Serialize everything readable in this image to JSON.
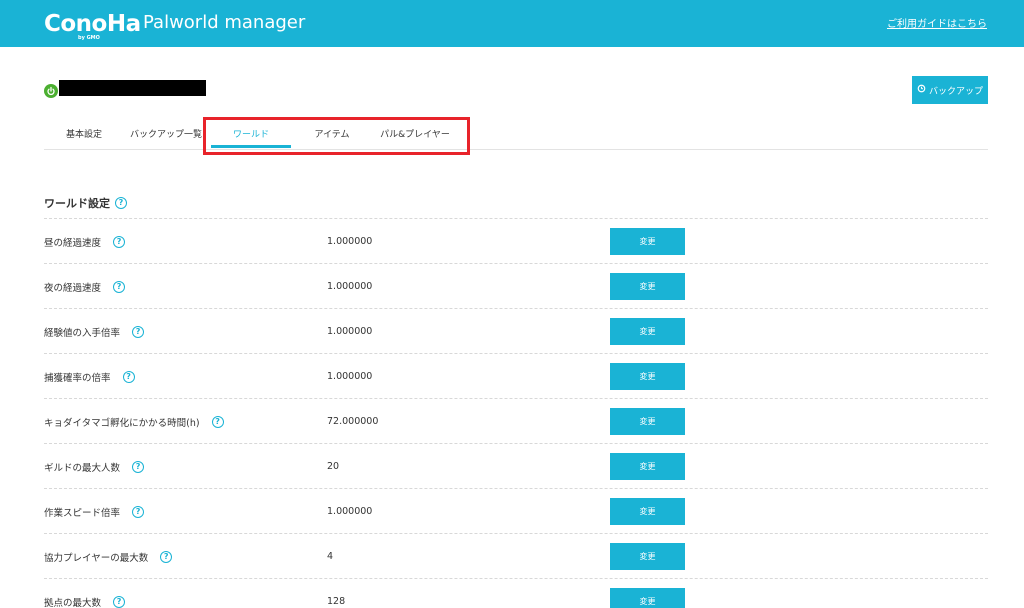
{
  "header": {
    "logo_text": "ConoHa",
    "logo_sub": "by GMO",
    "app_title": "Palworld manager",
    "guide_link": "ご利用ガイドはこちら"
  },
  "server": {
    "status_icon": "power-icon",
    "status_color": "#4caf31"
  },
  "actions": {
    "backup_label": "バックアップ"
  },
  "tabs": [
    {
      "label": "基本設定",
      "active": false
    },
    {
      "label": "バックアップ一覧",
      "active": false
    },
    {
      "label": "ワールド",
      "active": true
    },
    {
      "label": "アイテム",
      "active": false
    },
    {
      "label": "パル&プレイヤー",
      "active": false
    }
  ],
  "section": {
    "title": "ワールド設定"
  },
  "settings": [
    {
      "label": "昼の経過速度",
      "value": "1.000000",
      "button": "変更"
    },
    {
      "label": "夜の経過速度",
      "value": "1.000000",
      "button": "変更"
    },
    {
      "label": "経験値の入手倍率",
      "value": "1.000000",
      "button": "変更"
    },
    {
      "label": "捕獲確率の倍率",
      "value": "1.000000",
      "button": "変更"
    },
    {
      "label": "キョダイタマゴ孵化にかかる時間(h)",
      "value": "72.000000",
      "button": "変更"
    },
    {
      "label": "ギルドの最大人数",
      "value": "20",
      "button": "変更"
    },
    {
      "label": "作業スピード倍率",
      "value": "1.000000",
      "button": "変更"
    },
    {
      "label": "協力プレイヤーの最大数",
      "value": "4",
      "button": "変更"
    },
    {
      "label": "拠点の最大数",
      "value": "128",
      "button": "変更"
    }
  ],
  "colors": {
    "brand": "#1ab3d5",
    "highlight": "#e8232a",
    "status_on": "#4caf31"
  }
}
